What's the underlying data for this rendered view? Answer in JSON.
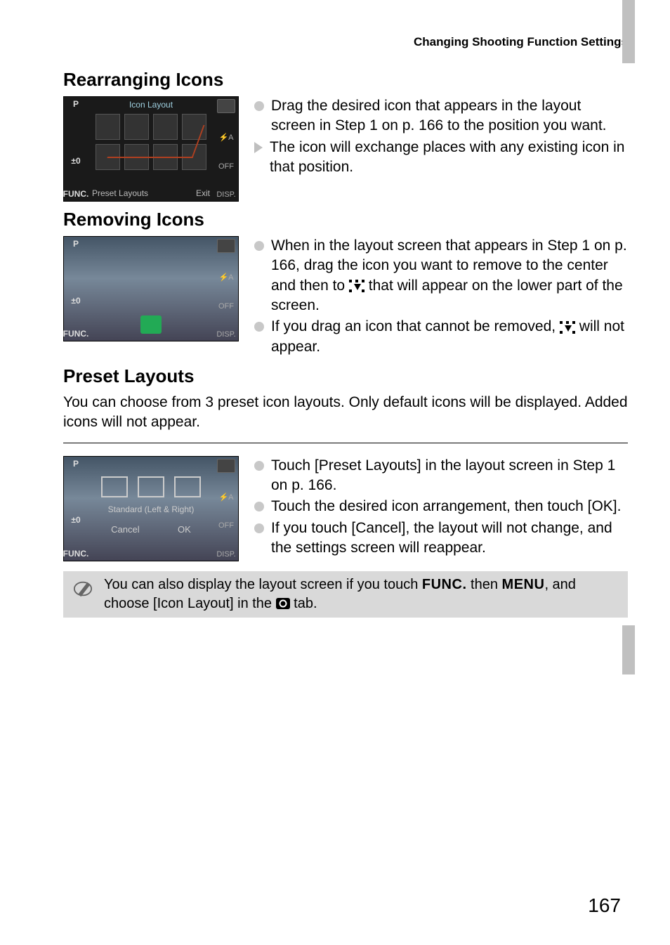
{
  "header": {
    "section_title": "Changing Shooting Function Settings"
  },
  "sections": {
    "rearranging": {
      "title": "Rearranging Icons",
      "thumb": {
        "title": "Icon Layout",
        "left_labels": [
          "P",
          "",
          "±0",
          "FUNC."
        ],
        "right_labels": [
          "",
          "⚡A",
          "OFF",
          "DISP."
        ],
        "bottom_left": "Preset Layouts",
        "bottom_right": "Exit"
      },
      "bullets": [
        "Drag the desired icon that appears in the layout screen in Step 1 on p. 166 to the position you want.",
        "The icon will exchange places with any existing icon in that position."
      ]
    },
    "removing": {
      "title": "Removing Icons",
      "thumb": {
        "left_labels": [
          "P",
          "",
          "±0",
          "FUNC."
        ],
        "right_labels": [
          "",
          "⚡A",
          "OFF",
          "DISP."
        ]
      },
      "bullet1_pre": "When in the layout screen that appears in Step 1 on p. 166, drag the icon you want to remove to the center and then to ",
      "bullet1_post": " that will appear on the lower part of the screen.",
      "bullet2_pre": "If you drag an icon that cannot be removed, ",
      "bullet2_post": " will not appear."
    },
    "preset": {
      "title": "Preset Layouts",
      "intro": "You can choose from 3 preset icon layouts. Only default icons will be displayed. Added icons will not appear.",
      "thumb": {
        "caption": "Standard (Left & Right)",
        "cancel": "Cancel",
        "ok": "OK"
      },
      "bullets": [
        "Touch [Preset Layouts] in the layout screen in Step 1 on p. 166.",
        "Touch the desired icon arrangement, then touch [OK].",
        "If you touch [Cancel], the layout will not change, and the settings screen will reappear."
      ]
    }
  },
  "note": {
    "pre": "You can also display the layout screen if you touch ",
    "func": "FUNC.",
    "mid1": " then ",
    "menu": "MENU",
    "mid2": ", and choose [Icon Layout] in the ",
    "post": " tab."
  },
  "page_number": "167"
}
